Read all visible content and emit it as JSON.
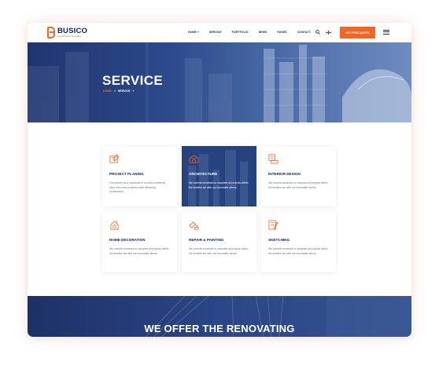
{
  "header": {
    "logo_name": "BUSICO",
    "logo_tagline": "Construction Template",
    "nav": [
      "HOME +",
      "SERVICE",
      "PORTFOLIO",
      "NEWS",
      "PAGES",
      "CONTACT"
    ],
    "cta_label": "GET FREE QUOTE"
  },
  "hero": {
    "title": "SERVICE",
    "breadcrumb_home": "HOME",
    "breadcrumb_sep": "»",
    "breadcrumb_current": "SERVICE",
    "breadcrumb_end": "»"
  },
  "services": [
    {
      "title": "PROJECT PLANING",
      "desc": "Our partner as a contractor is to build community value into every projects while delivering professional.",
      "icon": "blueprint-icon"
    },
    {
      "title": "ARCHITECTURE",
      "desc": "We commit ourselves to complete all projects within the timeline set with our honorable clients.",
      "icon": "architecture-icon"
    },
    {
      "title": "INTERIOR DESIGN",
      "desc": "We commit ourselves to complete all projects within the timeline set with our honorable clients.",
      "icon": "interior-design-icon"
    },
    {
      "title": "HOME DECORATION",
      "desc": "We commit ourselves to complete all projects within the timeline set with our honorable clients.",
      "icon": "home-decoration-icon"
    },
    {
      "title": "REPAIR & PAINTING",
      "desc": "We commit ourselves to complete all projects within the timeline set with our honorable clients.",
      "icon": "paint-roller-icon"
    },
    {
      "title": "SKETCHING",
      "desc": "We commit ourselves to complete all projects within the timeline set with our honorable clients.",
      "icon": "sketching-icon"
    }
  ],
  "banner": {
    "title": "WE OFFER THE RENOVATING"
  },
  "colors": {
    "accent": "#f26522",
    "navy": "#0d2152",
    "hero_blue": "#2b4888"
  }
}
